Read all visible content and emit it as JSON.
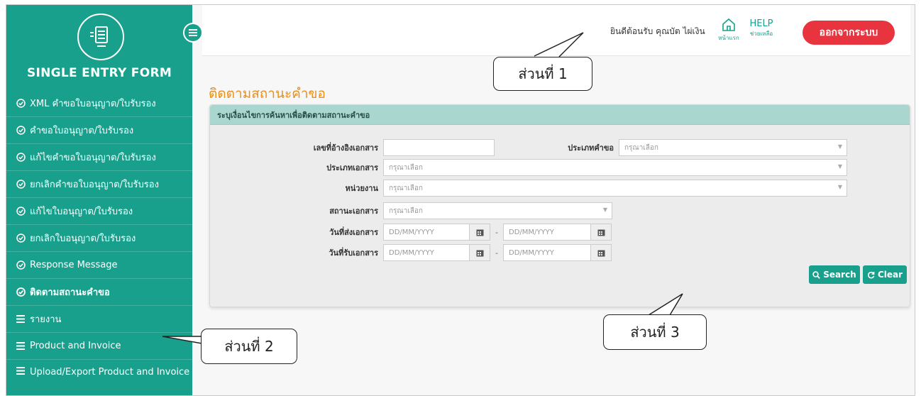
{
  "sidebar": {
    "title": "SINGLE ENTRY FORM",
    "items": [
      {
        "label": "XML คำขอใบอนุญาต/ใบรับรอง",
        "icon": "check-circle-icon"
      },
      {
        "label": "คำขอใบอนุญาต/ใบรับรอง",
        "icon": "check-circle-icon"
      },
      {
        "label": "แก้ไขคำขอใบอนุญาต/ใบรับรอง",
        "icon": "check-circle-icon"
      },
      {
        "label": "ยกเลิกคำขอใบอนุญาต/ใบรับรอง",
        "icon": "check-circle-icon"
      },
      {
        "label": "แก้ไขใบอนุญาต/ใบรับรอง",
        "icon": "check-circle-icon"
      },
      {
        "label": "ยกเลิกใบอนุญาต/ใบรับรอง",
        "icon": "check-circle-icon"
      },
      {
        "label": "Response Message",
        "icon": "check-circle-icon"
      },
      {
        "label": "ติดตามสถานะคำขอ",
        "icon": "check-circle-icon"
      },
      {
        "label": "รายงาน",
        "icon": "menu-icon"
      },
      {
        "label": "Product and Invoice",
        "icon": "menu-icon"
      },
      {
        "label": "Upload/Export Product and Invoice",
        "icon": "menu-icon"
      }
    ]
  },
  "header": {
    "welcome": "ยินดีต้อนรับ คุณบัต ไผ่เงิน",
    "home_label": "หน้าแรก",
    "help_text": "HELP",
    "help_label": "ช่วยเหลือ",
    "logout_label": "ออกจากระบบ"
  },
  "main": {
    "page_title": "ติดตามสถานะคำขอ",
    "panel_title": "ระบุเงื่อนไขการค้นหาเพื่อติดตามสถานะคำขอ",
    "fields": {
      "doc_ref_label": "เลขที่อ้างอิงเอกสาร",
      "doc_ref_value": "",
      "request_type_label": "ประเภทคำขอ",
      "request_type_placeholder": "กรุณาเลือก",
      "doc_type_label": "ประเภทเอกสาร",
      "doc_type_placeholder": "กรุณาเลือก",
      "agency_label": "หน่วยงาน",
      "agency_placeholder": "กรุณาเลือก",
      "doc_status_label": "สถานะเอกสาร",
      "doc_status_placeholder": "กรุณาเลือก",
      "sent_date_label": "วันที่ส่งเอกสาร",
      "received_date_label": "วันที่รับเอกสาร",
      "date_placeholder": "DD/MM/YYYY",
      "date_separator": "-"
    },
    "search_label": "Search",
    "clear_label": "Clear"
  },
  "callouts": {
    "part1": "ส่วนที่ 1",
    "part2": "ส่วนที่ 2",
    "part3": "ส่วนที่ 3"
  },
  "colors": {
    "sidebar_bg": "#19a08c",
    "title_orange": "#e98f1d",
    "logout_red": "#e8343f",
    "panel_header": "#a9d7d0"
  }
}
